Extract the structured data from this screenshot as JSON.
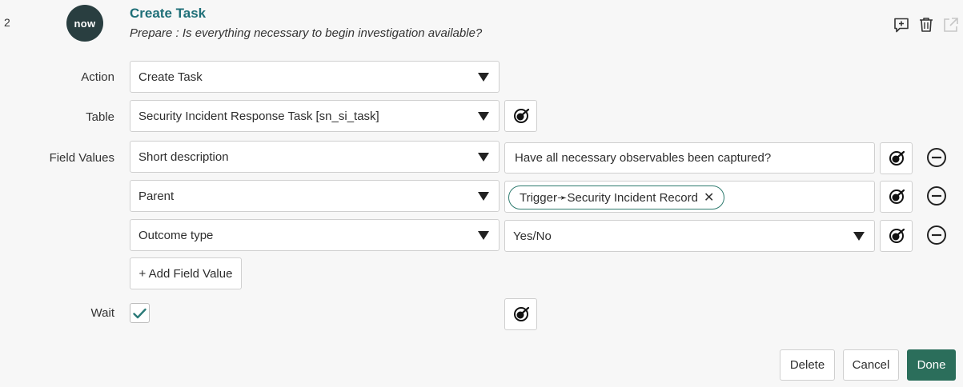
{
  "step": {
    "number": "2",
    "logo_text": "now",
    "title": "Create Task",
    "subtitle": "Prepare : Is everything necessary to begin investigation available?",
    "header_icons": [
      "add-comment-icon",
      "trash-icon",
      "external-link-icon"
    ]
  },
  "form": {
    "action": {
      "label": "Action",
      "value": "Create Task"
    },
    "table": {
      "label": "Table",
      "value": "Security Incident Response Task [sn_si_task]"
    },
    "field_values": {
      "label": "Field Values",
      "rows": [
        {
          "field": "Short description",
          "value": "Have all necessary observables been captured?"
        },
        {
          "field": "Parent",
          "pill": "Trigger➛Security Incident Record"
        },
        {
          "field": "Outcome type",
          "value": "Yes/No"
        }
      ],
      "add_label": "+ Add Field Value"
    },
    "wait": {
      "label": "Wait",
      "checked": true
    }
  },
  "footer": {
    "delete_label": "Delete",
    "cancel_label": "Cancel",
    "done_label": "Done"
  },
  "colors": {
    "accent": "#2b6e5b",
    "title": "#1f6f78",
    "logo_bg": "#293e40",
    "background": "#f7f7f7"
  }
}
